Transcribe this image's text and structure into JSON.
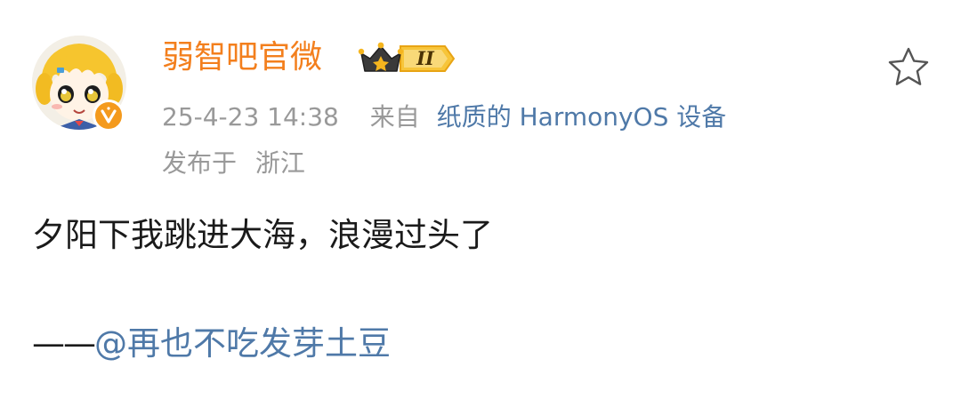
{
  "post": {
    "user": {
      "name": "弱智吧官微",
      "member_level": "II",
      "verified": true
    },
    "meta": {
      "time": "25-4-23 14:38",
      "source_prefix": "来自",
      "source_device": "纸质的 HarmonyOS 设备",
      "location_label": "发布于",
      "location_value": "浙江"
    },
    "content": {
      "text": "夕阳下我跳进大海，浪漫过头了",
      "signature_dash": "——",
      "mention": "@再也不吃发芽土豆"
    }
  },
  "icons": {
    "avatar": "anime-girl-avatar",
    "verified": "verified-v-badge-icon",
    "member": "crown-member-badge-icon",
    "favorite": "star-outline-icon"
  },
  "colors": {
    "username": "#f37f1d",
    "link": "#4f79a8",
    "meta": "#999999",
    "text": "#1a1a1a",
    "verified_badge": "#f49a1d",
    "member_badge": "#f5b51e"
  }
}
